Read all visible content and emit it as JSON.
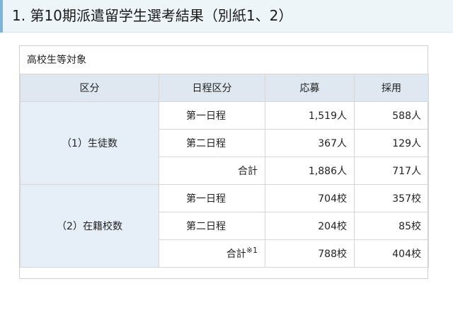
{
  "heading": {
    "title": "1. 第10期派遣留学生選考結果（別紙1、2）"
  },
  "table": {
    "caption": "高校生等対象",
    "headers": [
      "区分",
      "日程区分",
      "応募",
      "採用"
    ],
    "groups": [
      {
        "label": "（1）生徒数",
        "rows": [
          {
            "schedule": "第一日程",
            "applied": "1,519人",
            "hired": "588人"
          },
          {
            "schedule": "第二日程",
            "applied": "367人",
            "hired": "129人"
          },
          {
            "schedule": "合計",
            "note": "",
            "applied": "1,886人",
            "hired": "717人"
          }
        ]
      },
      {
        "label": "（2）在籍校数",
        "rows": [
          {
            "schedule": "第一日程",
            "applied": "704校",
            "hired": "357校"
          },
          {
            "schedule": "第二日程",
            "applied": "204校",
            "hired": "85校"
          },
          {
            "schedule": "合計",
            "note": "※1",
            "applied": "788校",
            "hired": "404校"
          }
        ]
      }
    ]
  }
}
